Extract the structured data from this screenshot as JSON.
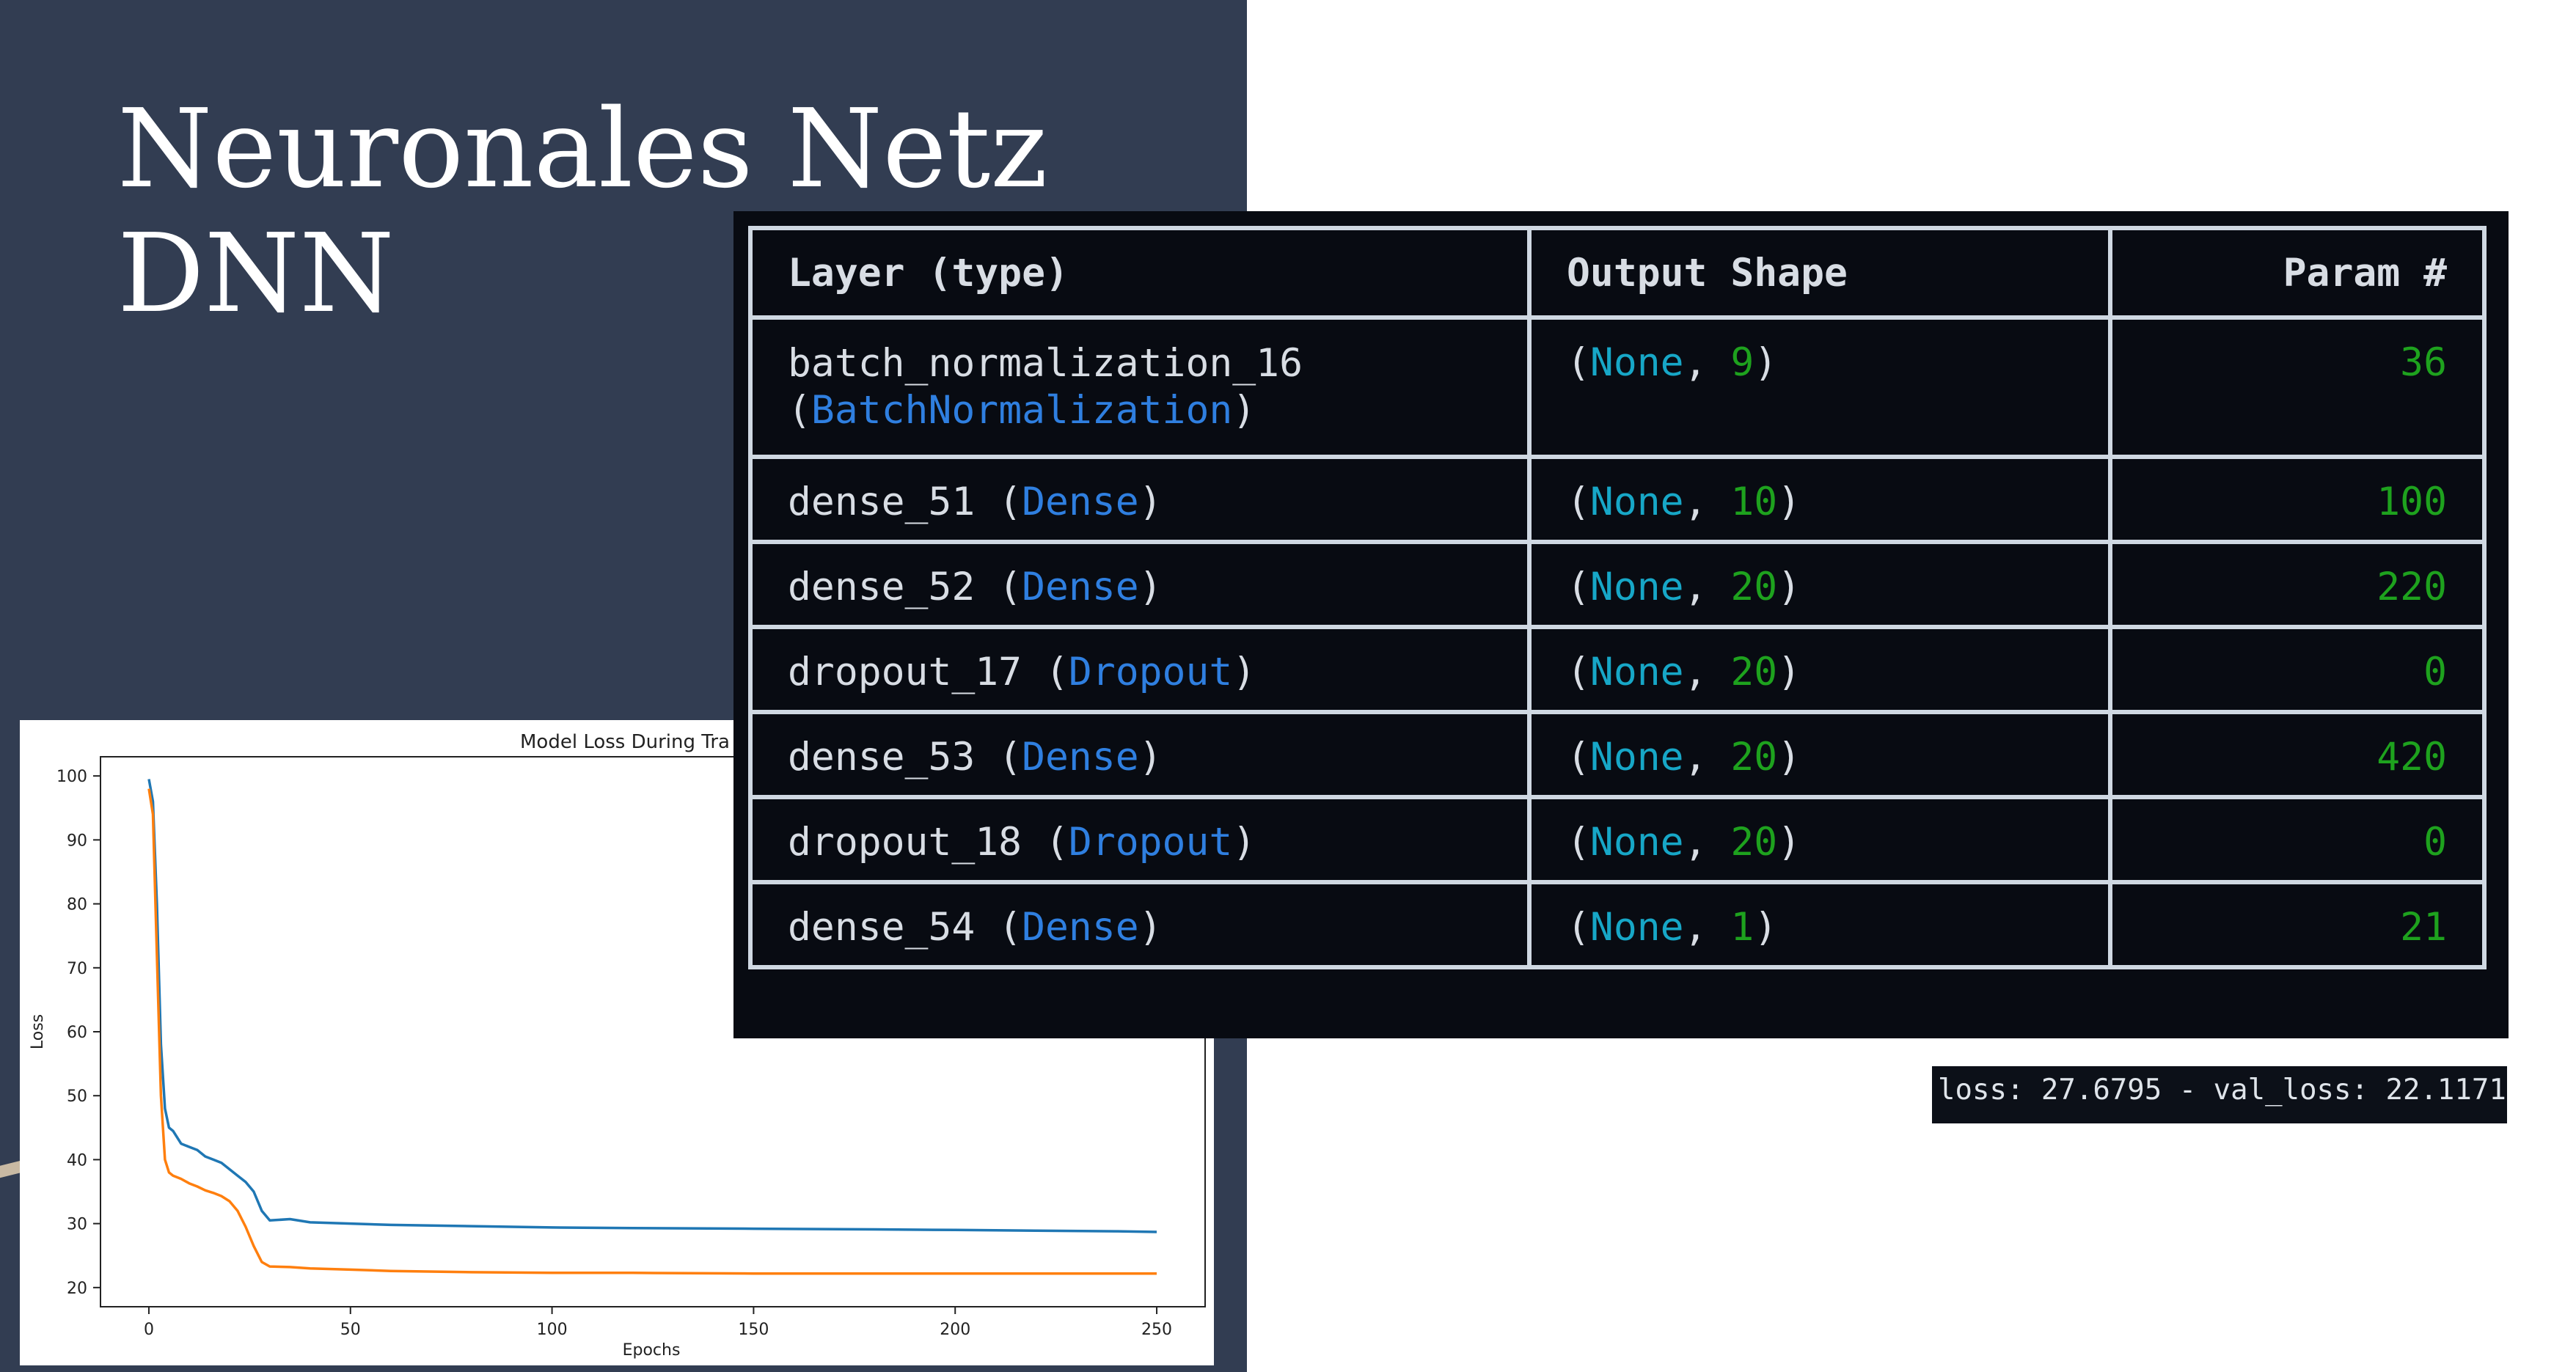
{
  "slide": {
    "title_line1": "Neuronales Netz",
    "title_line2": "DNN"
  },
  "model_summary": {
    "headers": [
      "Layer (type)",
      "Output Shape",
      "Param #"
    ],
    "rows": [
      {
        "name": "batch_normalization_16",
        "type": "BatchNormalization",
        "shape_prefix": "None",
        "shape_value": "9",
        "params": "36"
      },
      {
        "name": "dense_51",
        "type": "Dense",
        "shape_prefix": "None",
        "shape_value": "10",
        "params": "100"
      },
      {
        "name": "dense_52",
        "type": "Dense",
        "shape_prefix": "None",
        "shape_value": "20",
        "params": "220"
      },
      {
        "name": "dropout_17",
        "type": "Dropout",
        "shape_prefix": "None",
        "shape_value": "20",
        "params": "0"
      },
      {
        "name": "dense_53",
        "type": "Dense",
        "shape_prefix": "None",
        "shape_value": "20",
        "params": "420"
      },
      {
        "name": "dropout_18",
        "type": "Dropout",
        "shape_prefix": "None",
        "shape_value": "20",
        "params": "0"
      },
      {
        "name": "dense_54",
        "type": "Dense",
        "shape_prefix": "None",
        "shape_value": "1",
        "params": "21"
      }
    ],
    "colors": {
      "type": "#2f7fe0",
      "none": "#17a7c7",
      "number": "#1ea21e"
    }
  },
  "loss_output": "loss: 27.6795 - val_loss: 22.1171",
  "chart_data": {
    "type": "line",
    "title": "Model Loss During Tra",
    "xlabel": "Epochs",
    "ylabel": "Loss",
    "xlim": [
      -12,
      262
    ],
    "ylim": [
      17,
      103
    ],
    "xticks": [
      0,
      50,
      100,
      150,
      200,
      250
    ],
    "yticks": [
      20,
      30,
      40,
      50,
      60,
      70,
      80,
      90,
      100
    ],
    "grid": false,
    "series": [
      {
        "color": "#1f77b4",
        "x": [
          0,
          1,
          2,
          3,
          4,
          5,
          6,
          8,
          10,
          12,
          14,
          16,
          18,
          20,
          22,
          24,
          26,
          28,
          30,
          35,
          40,
          50,
          60,
          80,
          100,
          120,
          150,
          180,
          200,
          220,
          240,
          250
        ],
        "values": [
          99.5,
          96,
          80,
          58,
          48,
          45,
          44.5,
          42.5,
          42,
          41.5,
          40.5,
          40,
          39.5,
          38.5,
          37.5,
          36.5,
          35,
          32,
          30.5,
          30.7,
          30.2,
          30,
          29.8,
          29.6,
          29.4,
          29.3,
          29.2,
          29.1,
          29,
          28.9,
          28.8,
          28.7
        ]
      },
      {
        "color": "#ff7f0e",
        "x": [
          0,
          1,
          2,
          3,
          4,
          5,
          6,
          8,
          10,
          12,
          14,
          16,
          18,
          20,
          22,
          24,
          26,
          28,
          30,
          35,
          40,
          50,
          60,
          80,
          100,
          120,
          150,
          180,
          200,
          220,
          240,
          250
        ],
        "values": [
          98,
          94,
          72,
          50,
          40,
          38,
          37.5,
          37,
          36.3,
          35.8,
          35.2,
          34.8,
          34.3,
          33.5,
          32,
          29.5,
          26.5,
          24,
          23.3,
          23.2,
          23,
          22.8,
          22.6,
          22.4,
          22.3,
          22.3,
          22.2,
          22.2,
          22.2,
          22.2,
          22.2,
          22.2
        ]
      }
    ]
  }
}
